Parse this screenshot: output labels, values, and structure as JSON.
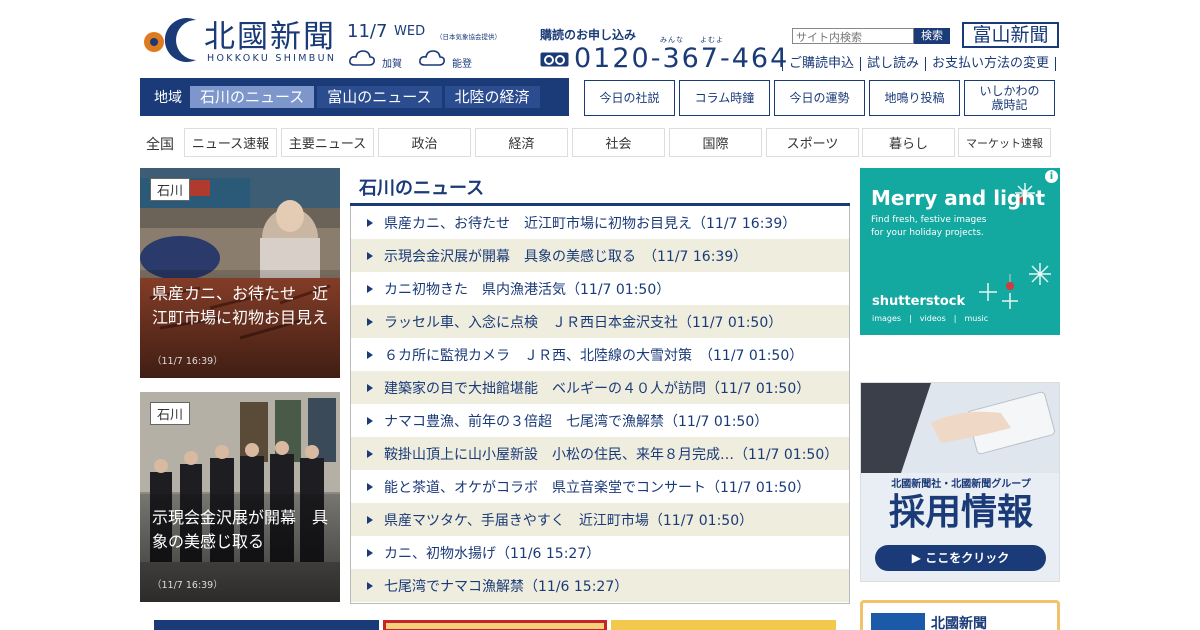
{
  "header": {
    "logo_text": "北國新聞",
    "logo_sub": "HOKKOKU SHIMBUN",
    "date": "11/7",
    "weekday": "WED",
    "weather_source": "（日本気象協会提供）",
    "weather": [
      {
        "area": "加賀",
        "icon": "cloud-icon"
      },
      {
        "area": "能登",
        "icon": "cloud-icon"
      }
    ],
    "subscribe_label": "購読のお申し込み",
    "phone_ruby": "みんな　　よむよ",
    "phone": "0120-367-464",
    "search_placeholder": "サイト内検索",
    "search_button": "検索",
    "toyama_link": "富山新聞",
    "top_links": [
      "ご購読申込",
      "試し読み",
      "お支払い方法の変更"
    ]
  },
  "region_nav": {
    "label": "地域",
    "items": [
      {
        "label": "石川のニュース",
        "active": true
      },
      {
        "label": "富山のニュース",
        "active": false
      },
      {
        "label": "北陸の経済",
        "active": false
      }
    ]
  },
  "column_buttons": [
    "今日の社説",
    "コラム時鐘",
    "今日の運勢",
    "地鳴り投稿",
    "いしかわの\n歳時記"
  ],
  "category_nav": {
    "label": "全国",
    "items": [
      "ニュース速報",
      "主要ニュース",
      "政治",
      "経済",
      "社会",
      "国際",
      "スポーツ",
      "暮らし",
      "マーケット速報"
    ]
  },
  "photos": [
    {
      "tag": "石川",
      "title": "県産カニ、お待たせ　近江町市場に初物お目見え",
      "time": "（11/7 16:39）"
    },
    {
      "tag": "石川",
      "title": "示現会金沢展が開幕　具象の美感じ取る",
      "time": "（11/7 16:39）"
    }
  ],
  "news": {
    "title": "石川のニュース",
    "items": [
      "県産カニ、お待たせ　近江町市場に初物お目見え（11/7 16:39）",
      "示現会金沢展が開幕　具象の美感じ取る　（11/7 16:39）",
      "カニ初物きた　県内漁港活気（11/7 01:50）",
      "ラッセル車、入念に点検　ＪＲ西日本金沢支社（11/7 01:50）",
      "６カ所に監視カメラ　ＪＲ西、北陸線の大雪対策　（11/7 01:50）",
      "建築家の目で大拙館堪能　ベルギーの４０人が訪問（11/7 01:50）",
      "ナマコ豊漁、前年の３倍超　七尾湾で漁解禁（11/7 01:50）",
      "鞍掛山頂上に山小屋新設　小松の住民、来年８月完成…（11/7 01:50）",
      "能と茶道、オケがコラボ　県立音楽堂でコンサート（11/7 01:50）",
      "県産マツタケ、手届きやすく　近江町市場（11/7 01:50）",
      "カニ、初物水揚げ（11/6 15:27）",
      "七尾湾でナマコ漁解禁（11/6 15:27）"
    ]
  },
  "ads": {
    "ad1_title": "Merry and light",
    "ad1_sub": "Find fresh, festive images\nfor your holiday projects.",
    "ad1_brand": "shutterstock",
    "ad1_links": "images　|　videos　|　music",
    "ad2_group": "北國新聞社・北國新聞グループ",
    "ad2_title": "採用情報",
    "ad2_button": "▶ ここをクリック",
    "ad3_text": "北國新聞"
  },
  "colors": {
    "brand": "#1a3a78",
    "stripe": "#efedde",
    "active_region": "#7d97cc"
  }
}
